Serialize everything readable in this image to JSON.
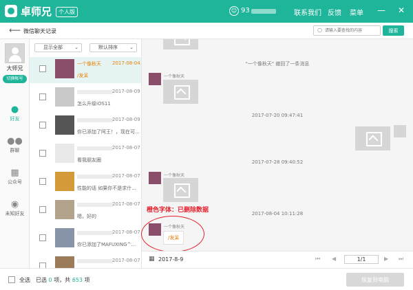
{
  "titlebar": {
    "app_name": "卓师兄",
    "edition": "个人版",
    "user_number": "93",
    "links": [
      "联系我们",
      "反馈",
      "菜单"
    ],
    "minimize": "—",
    "close": "✕"
  },
  "subheader": {
    "title": "微信聊天记录",
    "search_placeholder": "请输入要查找的内容",
    "search_button": "搜索"
  },
  "leftnav": {
    "username": "大师兄",
    "switch_account": "切换帐号",
    "items": [
      {
        "label": "好友",
        "icon": "person-icon"
      },
      {
        "label": "群聊",
        "icon": "group-icon"
      },
      {
        "label": "公众号",
        "icon": "grid-icon"
      },
      {
        "label": "未知好友",
        "icon": "unknown-user-icon"
      }
    ]
  },
  "list": {
    "filter_show": "显示全部",
    "filter_sort": "默认排序",
    "rows": [
      {
        "name": "一个像秋天",
        "date": "2017-08-04",
        "snippet": "/发呆"
      },
      {
        "date": "2017-08-09",
        "snippet": "怎么升级iOS11"
      },
      {
        "date": "2017-08-09",
        "snippet": "你已添加了阿王！，现在可..."
      },
      {
        "date": "2017-08-07",
        "snippet": "看我朋友圈"
      },
      {
        "date": "2017-08-07",
        "snippet": "性能的话 如果你不是求什..."
      },
      {
        "date": "2017-08-07",
        "snippet": "嗯，好的"
      },
      {
        "date": "2017-08-07",
        "snippet": "你已添加了MAFUXING^..."
      },
      {
        "date": "2017-08-07",
        "snippet": ""
      }
    ]
  },
  "chat": {
    "system_message": "\"一个像秋天\" 撤回了一条消息",
    "contact_name": "一个像秋天",
    "timestamps": [
      "2017-07-20 09:47:41",
      "2017-07-28 09:40:52",
      "2017-08-04 10:11:28"
    ],
    "last_bubble": "/发呆",
    "annotation": "橙色字体：已删除数据"
  },
  "calendar": {
    "date": "2017-8-9",
    "page": "1/1"
  },
  "bottom": {
    "select_all": "全选",
    "selected_prefix": "已选",
    "selected_count": "0",
    "selected_mid": "项，共",
    "total_count": "653",
    "selected_suffix": "项",
    "restore_button": "恢复到电脑"
  },
  "colors": {
    "accent": "#1fb59a",
    "deleted": "#e87e04",
    "annotation": "#e5202d"
  }
}
